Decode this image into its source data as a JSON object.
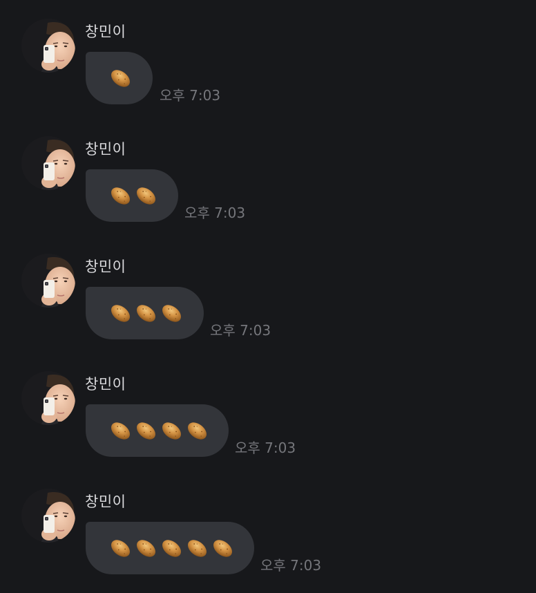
{
  "sender_name": "창민이",
  "message_time": "오후 7:03",
  "messages": [
    {
      "sender": "창민이",
      "content": "🥔",
      "potato_count": 1,
      "time": "오후 7:03"
    },
    {
      "sender": "창민이",
      "content": "🥔🥔",
      "potato_count": 2,
      "time": "오후 7:03"
    },
    {
      "sender": "창민이",
      "content": "🥔🥔🥔",
      "potato_count": 3,
      "time": "오후 7:03"
    },
    {
      "sender": "창민이",
      "content": "🥔🥔🥔🥔",
      "potato_count": 4,
      "time": "오후 7:03"
    },
    {
      "sender": "창민이",
      "content": "🥔🥔🥔🥔🥔",
      "potato_count": 5,
      "time": "오후 7:03"
    }
  ],
  "colors": {
    "background": "#17181b",
    "bubble": "#33353a",
    "sender_text": "#d9d9dc",
    "time_text": "#75767b",
    "potato": "#c98b3a"
  },
  "icons": {
    "avatar": "profile-photo-avatar",
    "potato": "potato-emoji"
  }
}
